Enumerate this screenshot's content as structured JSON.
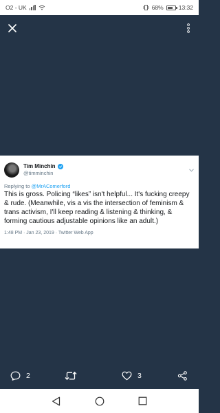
{
  "status_bar": {
    "carrier": "O2 - UK",
    "battery": "68%",
    "battery_level": 0.68,
    "time": "13:32"
  },
  "media_viewer": {
    "close_icon": "close-icon",
    "more_icon": "more-vertical-icon"
  },
  "tweet": {
    "display_name": "Tim Minchin",
    "handle": "@timminchin",
    "verified": true,
    "replying_prefix": "Replying to ",
    "replying_to": "@MrAComerford",
    "text": "This is gross. Policing “likes” isn't helpful... It's fucking creepy & rude. (Meanwhile, vis a vis the intersection of feminism & trans activism, I'll keep reading & listening & thinking, & forming cautious adjustable opinions like an adult.)",
    "meta": "1:48 PM · Jan 23, 2019 · Twitter Web App"
  },
  "actions": {
    "reply_count": "2",
    "retweet_count": "",
    "like_count": "3"
  },
  "colors": {
    "background": "#243447",
    "accent": "#1da1f2"
  }
}
